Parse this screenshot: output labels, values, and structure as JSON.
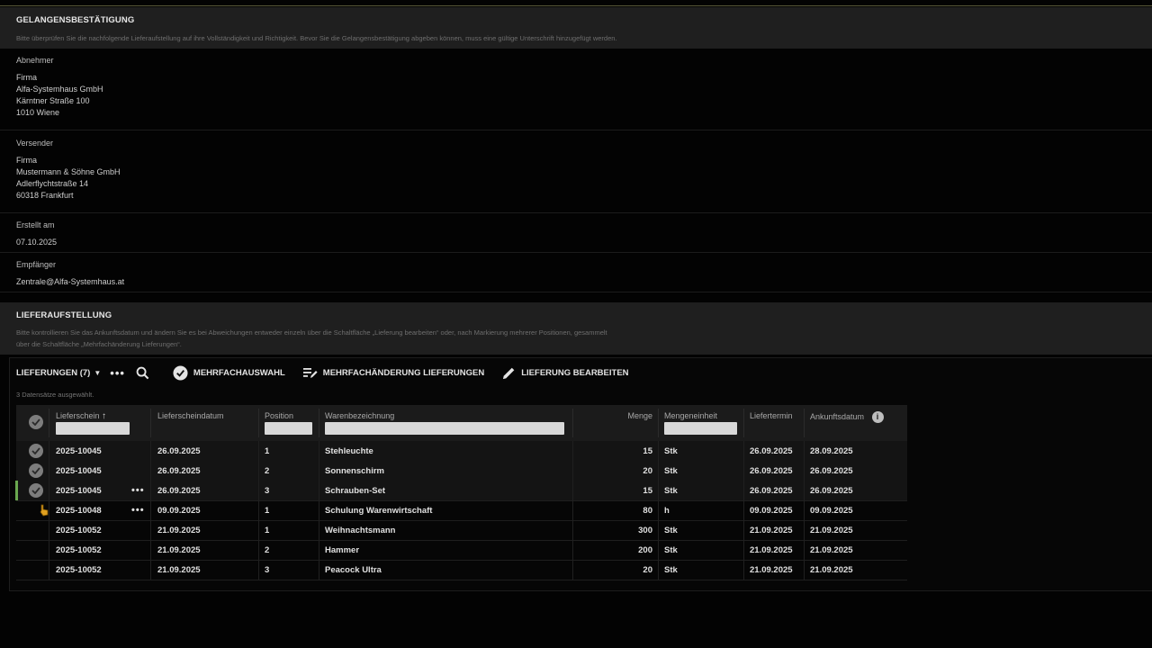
{
  "section1": {
    "title": "GELANGENSBESTÄTIGUNG",
    "description": "Bitte überprüfen Sie die nachfolgende Lieferaufstellung auf ihre Vollständigkeit und Richtigkeit. Bevor Sie die Gelangensbestätigung abgeben können, muss eine gültige Unterschrift hinzugefügt werden."
  },
  "abnehmer": {
    "label": "Abnehmer",
    "lines": [
      "Firma",
      "Alfa-Systemhaus GmbH",
      "Kärntner Straße 100",
      "1010 Wiene"
    ]
  },
  "versender": {
    "label": "Versender",
    "lines": [
      "Firma",
      "Mustermann & Söhne GmbH",
      "Adlerflychtstraße 14",
      "60318 Frankfurt"
    ]
  },
  "erstellt": {
    "label": "Erstellt am",
    "value": "07.10.2025"
  },
  "empfaenger": {
    "label": "Empfänger",
    "value": "Zentrale@Alfa-Systemhaus.at"
  },
  "section2": {
    "title": "LIEFERAUFSTELLUNG",
    "description_line1": "Bitte kontrollieren Sie das Ankunftsdatum und ändern Sie es bei Abweichungen entweder einzeln über die Schaltfläche „Lieferung bearbeiten“ oder, nach Markierung mehrerer Positionen, gesammelt",
    "description_line2": "über die Schaltfläche „Mehrfachänderung Lieferungen“."
  },
  "toolbar": {
    "lieferungen": "LIEFERUNGEN (7)",
    "mehrfachauswahl": "MEHRFACHAUSWAHL",
    "mehrfachaenderung": "MEHRFACHÄNDERUNG LIEFERUNGEN",
    "bearbeiten": "LIEFERUNG BEARBEITEN"
  },
  "selection_info": "3 Datensätze ausgewählt.",
  "columns": {
    "lieferschein": "Lieferschein",
    "lieferscheindatum": "Lieferscheindatum",
    "position": "Position",
    "warenbezeichnung": "Warenbezeichnung",
    "menge": "Menge",
    "mengeneinheit": "Mengeneinheit",
    "liefertermin": "Liefertermin",
    "ankunftsdatum": "Ankunftsdatum"
  },
  "rows": [
    {
      "lieferschein": "2025-10045",
      "datum": "26.09.2025",
      "position": "1",
      "ware": "Stehleuchte",
      "menge": "15",
      "einheit": "Stk",
      "liefertermin": "26.09.2025",
      "ankunft": "28.09.2025"
    },
    {
      "lieferschein": "2025-10045",
      "datum": "26.09.2025",
      "position": "2",
      "ware": "Sonnenschirm",
      "menge": "20",
      "einheit": "Stk",
      "liefertermin": "26.09.2025",
      "ankunft": "26.09.2025"
    },
    {
      "lieferschein": "2025-10045",
      "datum": "26.09.2025",
      "position": "3",
      "ware": "Schrauben-Set",
      "menge": "15",
      "einheit": "Stk",
      "liefertermin": "26.09.2025",
      "ankunft": "26.09.2025"
    },
    {
      "lieferschein": "2025-10048",
      "datum": "09.09.2025",
      "position": "1",
      "ware": "Schulung Warenwirtschaft",
      "menge": "80",
      "einheit": "h",
      "liefertermin": "09.09.2025",
      "ankunft": "09.09.2025"
    },
    {
      "lieferschein": "2025-10052",
      "datum": "21.09.2025",
      "position": "1",
      "ware": "Weihnachtsmann",
      "menge": "300",
      "einheit": "Stk",
      "liefertermin": "21.09.2025",
      "ankunft": "21.09.2025"
    },
    {
      "lieferschein": "2025-10052",
      "datum": "21.09.2025",
      "position": "2",
      "ware": "Hammer",
      "menge": "200",
      "einheit": "Stk",
      "liefertermin": "21.09.2025",
      "ankunft": "21.09.2025"
    },
    {
      "lieferschein": "2025-10052",
      "datum": "21.09.2025",
      "position": "3",
      "ware": "Peacock Ultra",
      "menge": "20",
      "einheit": "Stk",
      "liefertermin": "21.09.2025",
      "ankunft": "21.09.2025"
    }
  ]
}
